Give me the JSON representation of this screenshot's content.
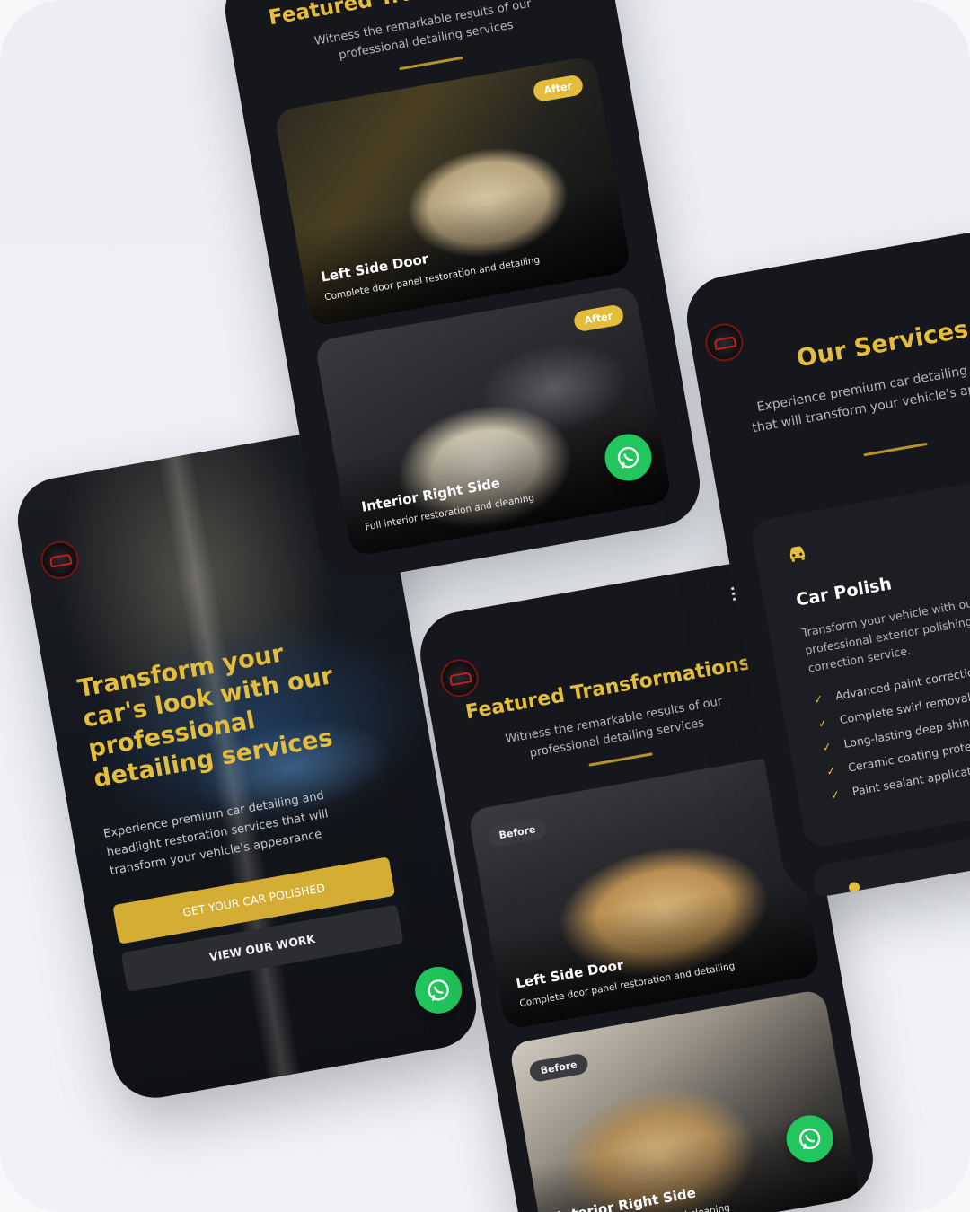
{
  "colors": {
    "accent": "#e4bd3d",
    "phone_bg": "#16171c",
    "whatsapp": "#22c55e"
  },
  "hero": {
    "title": "Transform your car's look with our professional detailing services",
    "subtitle": "Experience premium car detailing and headlight restoration services that will transform your vehicle's appearance",
    "cta_primary": "GET YOUR CAR POLISHED",
    "cta_secondary": "VIEW OUR WORK"
  },
  "featured_top": {
    "title": "Featured Transformations",
    "subtitle": "Witness the remarkable results of our professional detailing services",
    "cards": [
      {
        "badge": "After",
        "title": "Left Side Door",
        "caption": "Complete door panel restoration and detailing"
      },
      {
        "badge": "After",
        "title": "Interior Right Side",
        "caption": "Full interior restoration and cleaning"
      }
    ]
  },
  "featured_bottom": {
    "title": "Featured Transformations",
    "subtitle": "Witness the remarkable results of our professional detailing services",
    "cards": [
      {
        "badge": "Before",
        "title": "Left Side Door",
        "caption": "Complete door panel restoration and detailing"
      },
      {
        "badge": "Before",
        "title": "Interior Right Side",
        "caption": "Full interior restoration and cleaning"
      }
    ]
  },
  "services": {
    "title": "Our Services",
    "subtitle": "Experience premium car detailing services that will transform your vehicle's appearance",
    "card": {
      "icon": "car-icon",
      "title": "Car Polish",
      "description": "Transform your vehicle with our professional exterior polishing and correction service.",
      "features": [
        "Advanced paint correction",
        "Complete swirl removal",
        "Long-lasting deep shine",
        "Ceramic coating protection",
        "Paint sealant application"
      ]
    },
    "next_card_icon": "lightbulb-icon"
  },
  "icons": {
    "menu": "hamburger-icon",
    "logo": "brand-logo",
    "chat": "whatsapp-icon",
    "check": "check-icon"
  }
}
